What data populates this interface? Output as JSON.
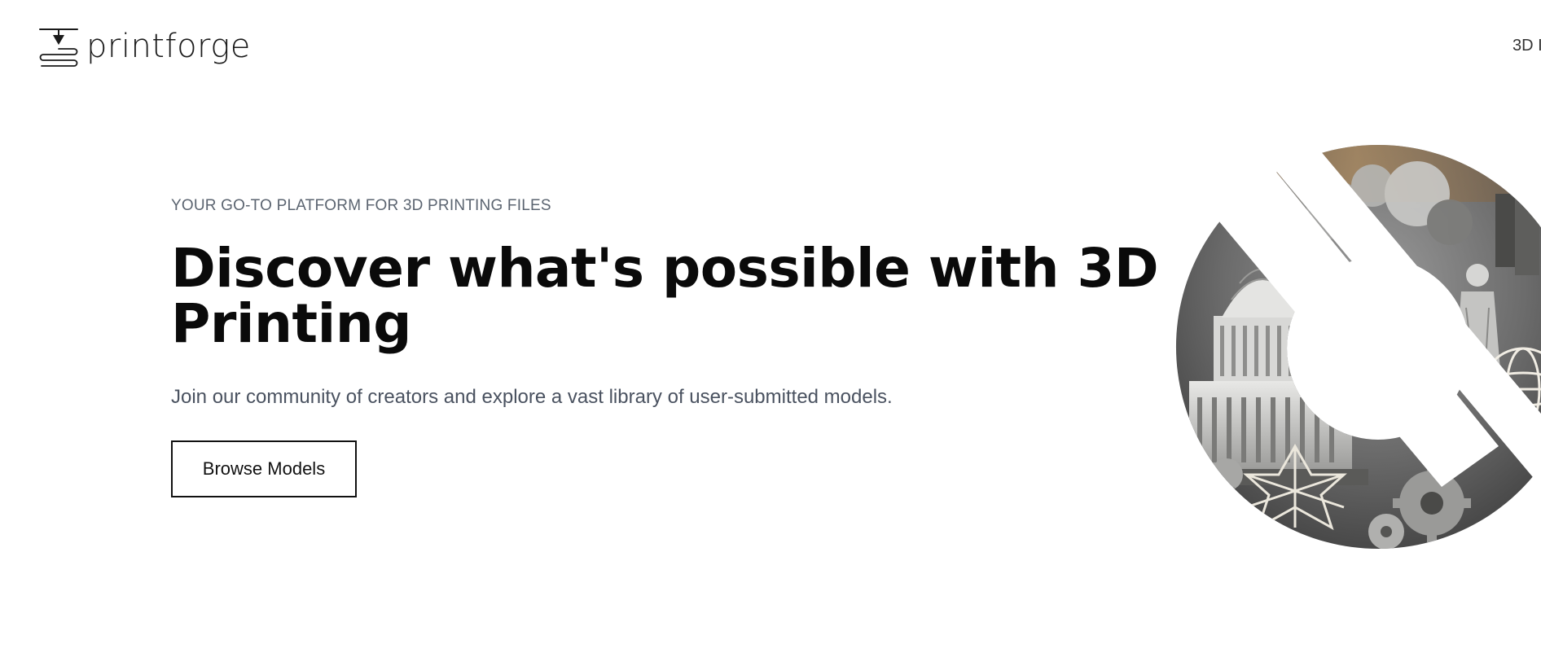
{
  "header": {
    "brand": "printforge",
    "logo_icon": "printer-nozzle-icon",
    "nav": [
      {
        "label": "3D I"
      }
    ]
  },
  "hero": {
    "eyebrow": "YOUR GO-TO PLATFORM FOR 3D PRINTING FILES",
    "title": "Discover what's possible with 3D Printing",
    "subtitle": "Join our community of creators and explore a vast library of user-submitted models.",
    "cta_label": "Browse Models",
    "image": {
      "description_icon": "3d-printed-models-collage",
      "subjects": [
        "capitol-building-model",
        "star-lattice-model",
        "gear-model",
        "statue-model",
        "lattice-sphere-model"
      ]
    }
  },
  "colors": {
    "text_primary": "#0a0a0a",
    "text_muted": "#5b6470",
    "background": "#ffffff",
    "border": "#111111"
  }
}
